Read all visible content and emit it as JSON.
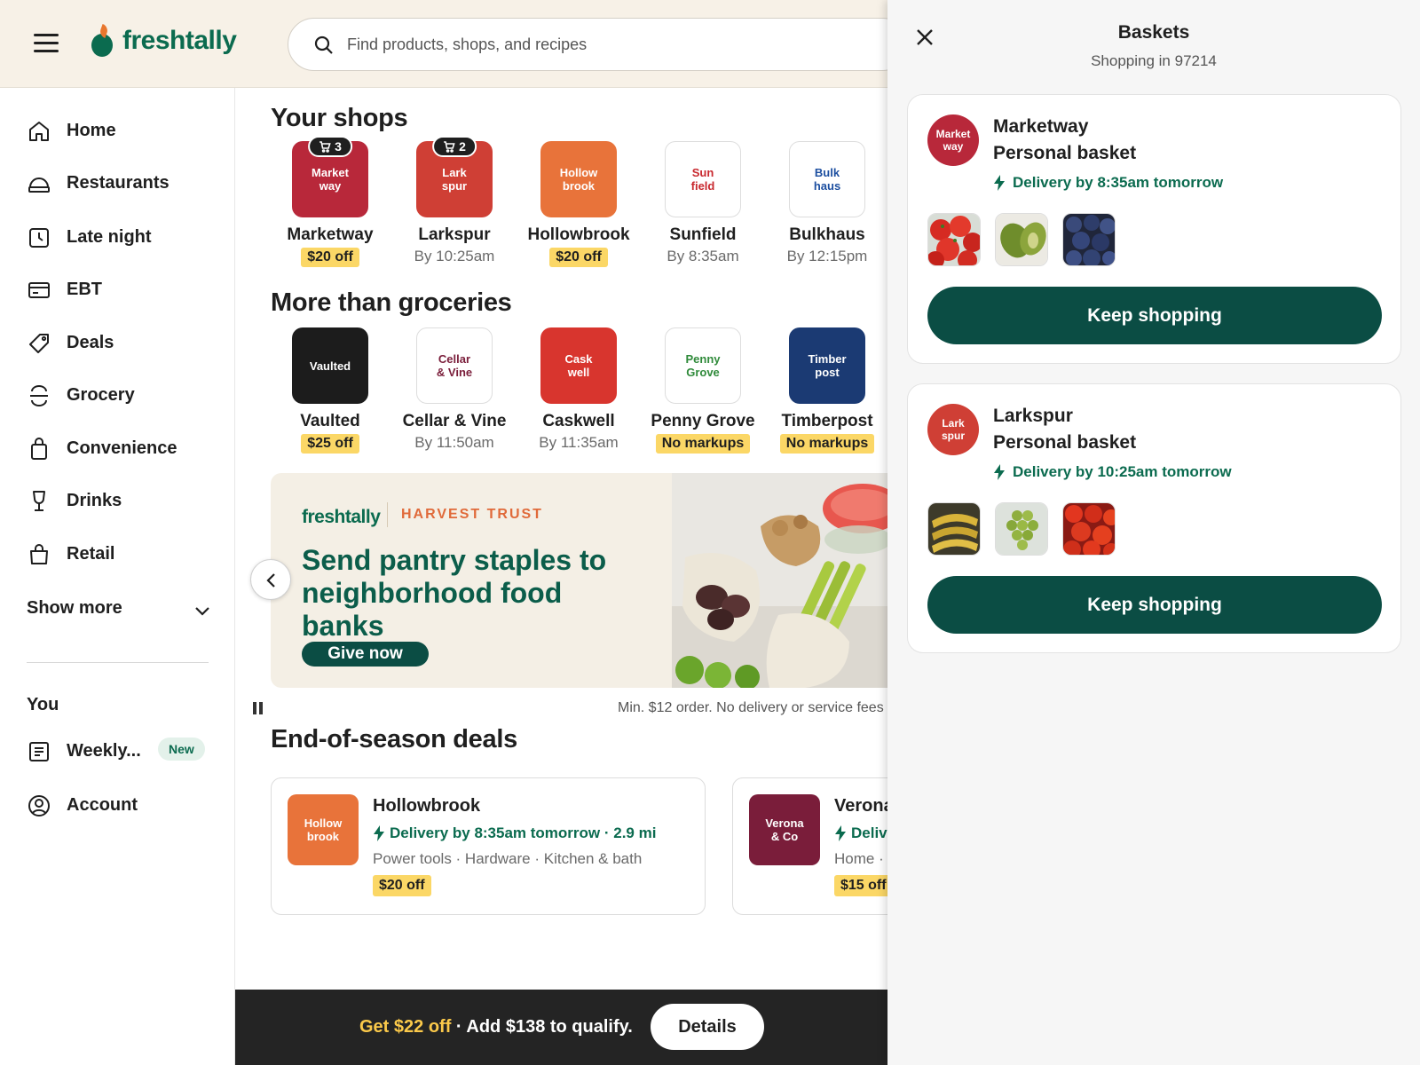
{
  "header": {
    "brand": "freshtally",
    "search_placeholder": "Find products, shops, and recipes"
  },
  "sidebar": {
    "items": [
      {
        "label": "Home",
        "icon": "home-icon"
      },
      {
        "label": "Restaurants",
        "icon": "restaurant-icon"
      },
      {
        "label": "Late night",
        "icon": "clock-icon"
      },
      {
        "label": "EBT",
        "icon": "card-icon"
      },
      {
        "label": "Deals",
        "icon": "tag-icon"
      },
      {
        "label": "Grocery",
        "icon": "grocery-icon"
      },
      {
        "label": "Convenience",
        "icon": "bag-icon"
      },
      {
        "label": "Drinks",
        "icon": "wine-glass-icon"
      },
      {
        "label": "Retail",
        "icon": "shopping-bag-icon"
      }
    ],
    "show_more": "Show more",
    "you_heading": "You",
    "you_items": [
      {
        "label": "Weekly...",
        "badge": "New",
        "icon": "list-icon"
      },
      {
        "label": "Account",
        "icon": "account-icon"
      }
    ]
  },
  "your_shops": {
    "title": "Your shops",
    "shops": [
      {
        "logo": "Market\nway",
        "name": "Marketway",
        "badge": "$20 off",
        "cart_count": "3",
        "color": "#b8283a"
      },
      {
        "logo": "Lark\nspur",
        "name": "Larkspur",
        "sub": "By 10:25am",
        "cart_count": "2",
        "color": "#cf3f35"
      },
      {
        "logo": "Hollow\nbrook",
        "name": "Hollowbrook",
        "badge": "$20 off",
        "color": "#e8733a"
      },
      {
        "logo": "Sun\nfield",
        "name": "Sunfield",
        "sub": "By 8:35am",
        "color": "#ffffff",
        "text_color": "#c8282e"
      },
      {
        "logo": "Bulk\nhaus",
        "name": "Bulkhaus",
        "sub": "By 12:15pm",
        "color": "#ffffff",
        "text_color": "#1d4fa0"
      }
    ]
  },
  "more_groceries": {
    "title": "More than groceries",
    "shops": [
      {
        "logo": "Vaulted",
        "name": "Vaulted",
        "badge": "$25 off",
        "color": "#1c1c1c"
      },
      {
        "logo": "Cellar\n& Vine",
        "name": "Cellar & Vine",
        "sub": "By 11:50am",
        "color": "#ffffff",
        "text_color": "#7a1d3a"
      },
      {
        "logo": "Cask\nwell",
        "name": "Caskwell",
        "sub": "By 11:35am",
        "color": "#d8352e"
      },
      {
        "logo": "Penny\nGrove",
        "name": "Penny Grove",
        "badge": "No markups",
        "color": "#ffffff",
        "text_color": "#2f8a3a"
      },
      {
        "logo": "Timber\npost",
        "name": "Timberpost",
        "badge": "No markups",
        "color": "#1b3a73"
      }
    ]
  },
  "promo": {
    "brand": "freshtally",
    "partner": "HARVEST TRUST",
    "headline": "Send pantry staples to neighborhood food banks",
    "cta": "Give now",
    "note": "Min. $12 order. No delivery or service fees"
  },
  "deals": {
    "title": "End-of-season deals",
    "cards": [
      {
        "logo": "Hollow\nbrook",
        "name": "Hollowbrook",
        "delivery": "Delivery by 8:35am tomorrow · 2.9 mi",
        "categories": "Power tools · Hardware · Kitchen & bath",
        "badge": "$20 off",
        "color": "#e8733a"
      },
      {
        "logo": "Verona\n& Co",
        "name": "Verona",
        "delivery": "Deliv",
        "categories": "Home ·",
        "badge": "$15 off",
        "color": "#7a1d3a"
      }
    ]
  },
  "bottom_banner": {
    "highlight": "Get $22 off",
    "text": " · Add $138 to qualify.",
    "button": "Details"
  },
  "baskets_panel": {
    "title": "Baskets",
    "subtitle": "Shopping in 97214",
    "baskets": [
      {
        "logo": "Market\nway",
        "store": "Marketway",
        "type": "Personal basket",
        "delivery": "Delivery by 8:35am tomorrow",
        "button": "Keep shopping",
        "color": "#b8283a",
        "thumbs": [
          "strawberries",
          "avocados",
          "blueberries"
        ]
      },
      {
        "logo": "Lark\nspur",
        "store": "Larkspur",
        "type": "Personal basket",
        "delivery": "Delivery by 10:25am tomorrow",
        "button": "Keep shopping",
        "color": "#cf3f35",
        "thumbs": [
          "bananas",
          "grapes",
          "tomatoes"
        ]
      }
    ]
  },
  "colors": {
    "brand_green": "#0b6b4f",
    "button_dark_green": "#0b4d44",
    "badge_yellow": "#fbd766",
    "header_bg": "#f7f1e7"
  }
}
